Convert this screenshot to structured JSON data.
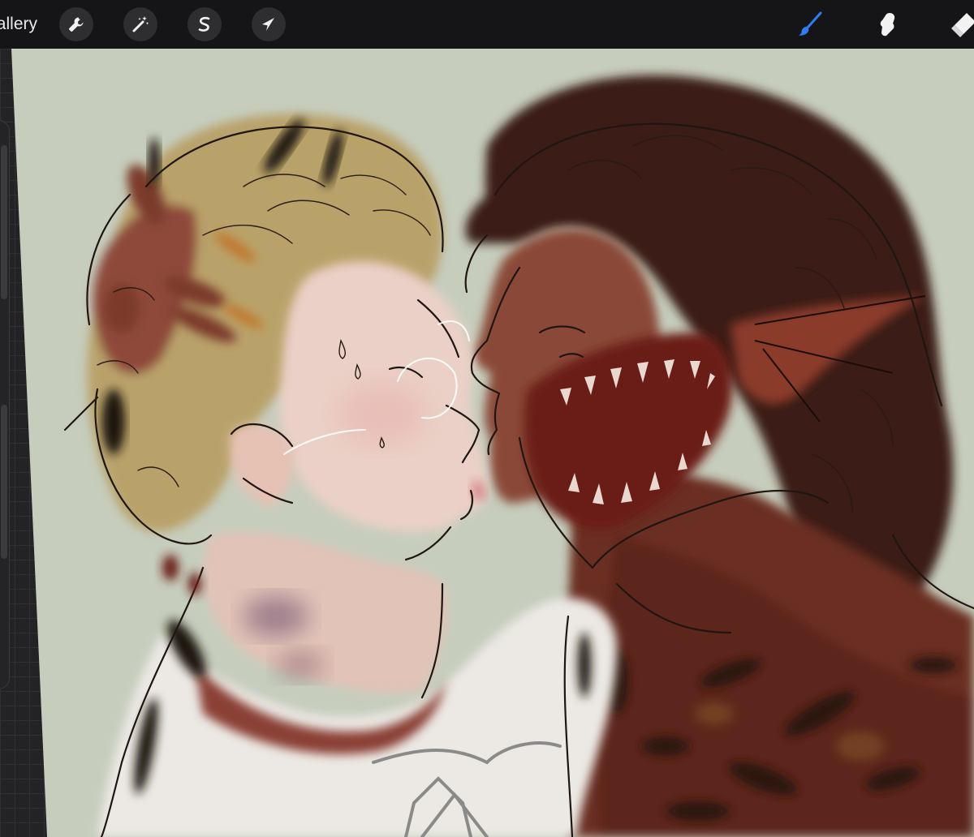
{
  "toolbar": {
    "gallery_label": "Gallery",
    "tools_left": [
      {
        "name": "actions",
        "icon": "wrench-icon"
      },
      {
        "name": "adjustments",
        "icon": "magic-wand-icon"
      },
      {
        "name": "selection",
        "icon": "selection-s-icon"
      },
      {
        "name": "transform",
        "icon": "arrow-cursor-icon"
      }
    ],
    "tools_right": [
      {
        "name": "brush",
        "icon": "brush-icon",
        "active": true
      },
      {
        "name": "smudge",
        "icon": "smudge-icon"
      },
      {
        "name": "eraser",
        "icon": "eraser-icon"
      }
    ]
  },
  "colors": {
    "toolbar_bg": "#151517",
    "canvas_bg": "#c6cdbd",
    "accent": "#2f7cf6"
  }
}
